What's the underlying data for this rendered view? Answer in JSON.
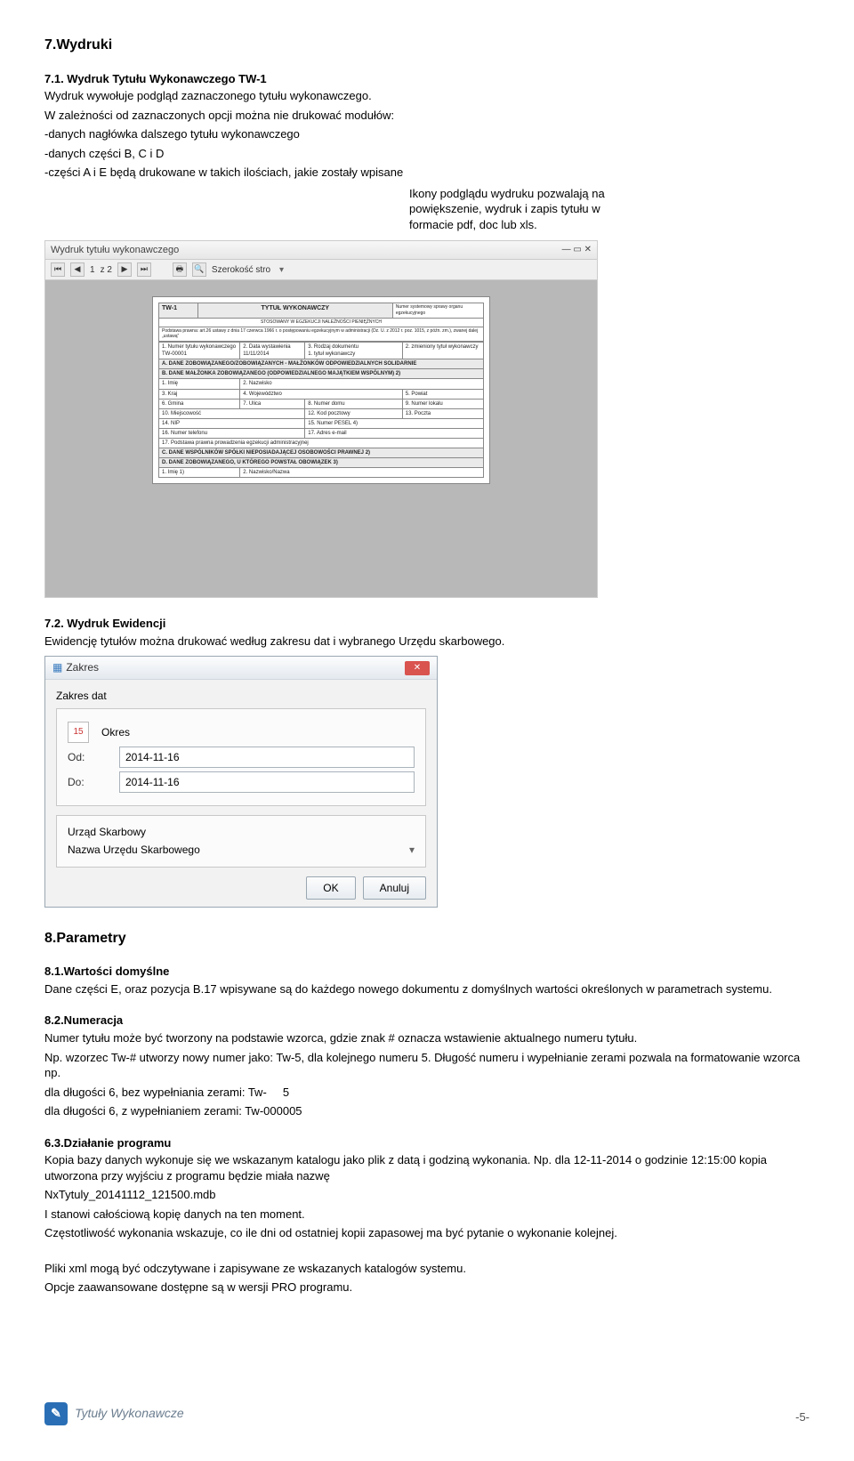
{
  "s7": {
    "title": "7.Wydruki",
    "s71_title": "7.1. Wydruk Tytułu Wykonawczego TW-1",
    "s71_p1": "Wydruk wywołuje podgląd zaznaczonego tytułu wykonawczego.",
    "s71_p2": "W zależności od zaznaczonych opcji można nie drukować modułów:",
    "s71_li1": "-danych nagłówka dalszego tytułu wykonawczego",
    "s71_li2": "-danych części B, C i D",
    "s71_li3": "-części A i E będą drukowane w takich ilościach, jakie zostały wpisane",
    "note": "Ikony podglądu wydruku pozwalają na powiększenie, wydruk i zapis tytułu w formacie pdf, doc lub xls.",
    "s72_title": "7.2. Wydruk Ewidencji",
    "s72_p1": "Ewidencję tytułów można drukować według zakresu dat i wybranego Urzędu skarbowego."
  },
  "preview": {
    "window_title": "Wydruk tytułu wykonawczego",
    "toolbar_page": "1",
    "toolbar_zoom_label": "Szerokość stro",
    "toolbar_of": "z 2"
  },
  "form": {
    "tw1": "TW-1",
    "title": "TYTUŁ WYKONAWCZY",
    "subtitle": "STOSOWANY W EGZEKUCJI NALEŻNOŚCI PIENIĘŻNYCH",
    "basis": "Podstawa prawna: art.26 ustawy z dnia 17 czerwca 1966 r. o postępowaniu egzekucyjnym w administracji (Dz. U. z 2012 r. poz. 1015, z późn. zm.), zwanej dalej „ustawą”",
    "right_top": "Numer systemowy sprawy organu egzekucyjnego",
    "r1c1": "1. Numer tytułu wykonawczego",
    "r1v1": "TW-00001",
    "r1c2": "2. Data wystawienia",
    "r1v2": "11/11/2014",
    "r1c3": "3. Rodzaj dokumentu",
    "r1v3": "1. tytuł wykonawczy",
    "r1c4": "2. zmieniony tytuł wykonawczy",
    "secA": "A. DANE ZOBOWIĄZANEGO/ZOBOWIĄZANYCH - MAŁŻONKÓW ODPOWIEDZIALNYCH SOLIDARNIE",
    "secB": "B. DANE MAŁŻONKA ZOBOWIĄZANEGO (ODPOWIEDZIALNEGO MAJĄTKIEM WSPÓLNYM) 2)",
    "f1": "1. Imię",
    "f2": "2. Nazwisko",
    "f3": "3. Kraj",
    "f4": "4. Województwo",
    "f5": "5. Powiat",
    "f6": "6. Gmina",
    "f7": "7. Ulica",
    "f8": "8. Numer domu",
    "f9": "9. Numer lokalu",
    "f10": "10. Miejscowość",
    "f11": "12. Kod pocztowy",
    "f12": "13. Poczta",
    "f14": "14. NIP",
    "f15": "15. Numer PESEL 4)",
    "f16": "16. Numer telefonu",
    "f17": "17. Adres e-mail",
    "f18": "17. Podstawa prawna prowadzenia egzekucji administracyjnej",
    "secC": "C. DANE WSPÓLNIKÓW SPÓŁKI NIEPOSIADAJĄCEJ OSOBOWOŚCI PRAWNEJ 2)",
    "secD": "D. DANE ZOBOWIĄZANEGO, U KTÓREGO POWSTAŁ OBOWIĄZEK 3)",
    "d1": "1. Imię 1)",
    "d2": "2. Nazwisko/Nazwa"
  },
  "dialog": {
    "title": "Zakres",
    "group": "Zakres dat",
    "okres": "Okres",
    "od": "Od:",
    "do": "Do:",
    "od_val": "2014-11-16",
    "do_val": "2014-11-16",
    "us_label": "Urząd Skarbowy",
    "us_val": "Nazwa Urzędu Skarbowego",
    "ok": "OK",
    "cancel": "Anuluj",
    "cal": "15"
  },
  "s8": {
    "title": "8.Parametry",
    "s81_title": "8.1.Wartości domyślne",
    "s81_p": "Dane części E, oraz pozycja B.17 wpisywane są do każdego nowego dokumentu z domyślnych wartości określonych w parametrach systemu.",
    "s82_title": "8.2.Numeracja",
    "s82_p1": "Numer tytułu może być tworzony na podstawie wzorca, gdzie znak # oznacza wstawienie aktualnego numeru tytułu.",
    "s82_p2": "Np. wzorzec Tw-# utworzy nowy numer jako: Tw-5, dla kolejnego numeru 5. Długość numeru i wypełnianie zerami pozwala na formatowanie wzorca np.",
    "s82_p3": "dla długości 6, bez wypełniania zerami: Tw-     5",
    "s82_p4": "dla długości 6, z wypełnianiem zerami: Tw-000005",
    "s63_title": "6.3.Działanie programu",
    "s63_p1": "Kopia bazy danych wykonuje się we wskazanym katalogu jako plik z datą i godziną wykonania. Np. dla 12-11-2014 o godzinie 12:15:00 kopia utworzona przy wyjściu z programu będzie miała nazwę",
    "s63_p2": "NxTytuly_20141112_121500.mdb",
    "s63_p3": "I stanowi całościową kopię danych na ten moment.",
    "s63_p4": "Częstotliwość wykonania wskazuje, co ile dni od ostatniej kopii zapasowej ma być pytanie o wykonanie kolejnej.",
    "s63_p5": "Pliki xml mogą być odczytywane i zapisywane ze wskazanych katalogów systemu.",
    "s63_p6": "Opcje zaawansowane dostępne są w wersji PRO programu."
  },
  "footer": {
    "brand": "Tytuły Wykonawcze",
    "page": "-5-"
  }
}
